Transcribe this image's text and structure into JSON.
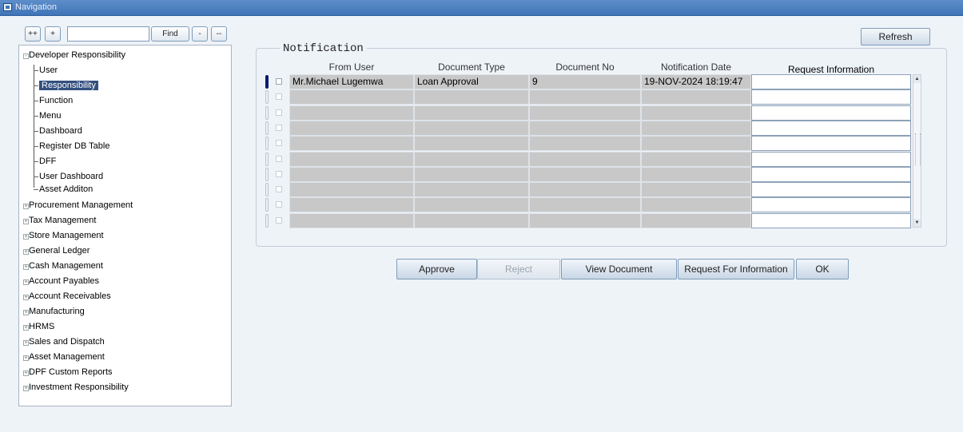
{
  "window": {
    "title": "Navigation"
  },
  "nav": {
    "expand_all_label": "++",
    "expand_label": "+",
    "search_value": "",
    "find_label": "Find",
    "collapse_label": "-",
    "collapse_all_label": "--",
    "tree": [
      {
        "label": "Developer Responsibility",
        "level": 0,
        "expanded": true
      },
      {
        "label": "User",
        "level": 1
      },
      {
        "label": "Responsibility",
        "level": 1,
        "selected": true
      },
      {
        "label": "Function",
        "level": 1
      },
      {
        "label": "Menu",
        "level": 1
      },
      {
        "label": "Dashboard",
        "level": 1
      },
      {
        "label": "Register DB Table",
        "level": 1
      },
      {
        "label": "DFF",
        "level": 1
      },
      {
        "label": "User Dashboard",
        "level": 1
      },
      {
        "label": "Asset Additon",
        "level": 1
      },
      {
        "label": "Procurement Management",
        "level": 0
      },
      {
        "label": "Tax Management",
        "level": 0
      },
      {
        "label": "Store Management",
        "level": 0
      },
      {
        "label": "General Ledger",
        "level": 0
      },
      {
        "label": "Cash Management",
        "level": 0
      },
      {
        "label": "Account Payables",
        "level": 0
      },
      {
        "label": "Account Receivables",
        "level": 0
      },
      {
        "label": "Manufacturing",
        "level": 0
      },
      {
        "label": "HRMS",
        "level": 0
      },
      {
        "label": "Sales and Dispatch",
        "level": 0
      },
      {
        "label": "Asset Management",
        "level": 0
      },
      {
        "label": "DPF Custom Reports",
        "level": 0
      },
      {
        "label": "Investment Responsibility",
        "level": 0
      }
    ]
  },
  "notification": {
    "refresh_label": "Refresh",
    "group_title": "Notification",
    "columns": {
      "from_user": "From User",
      "document_type": "Document Type",
      "document_no": "Document No",
      "notification_date": "Notification Date",
      "request_information": "Request Information"
    },
    "rows": [
      {
        "from_user": "Mr.Michael Lugemwa",
        "document_type": "Loan Approval",
        "document_no": "9",
        "notification_date": "19-NOV-2024 18:19:47",
        "request_information": ""
      },
      {
        "from_user": "",
        "document_type": "",
        "document_no": "",
        "notification_date": "",
        "request_information": ""
      },
      {
        "from_user": "",
        "document_type": "",
        "document_no": "",
        "notification_date": "",
        "request_information": ""
      },
      {
        "from_user": "",
        "document_type": "",
        "document_no": "",
        "notification_date": "",
        "request_information": ""
      },
      {
        "from_user": "",
        "document_type": "",
        "document_no": "",
        "notification_date": "",
        "request_information": ""
      },
      {
        "from_user": "",
        "document_type": "",
        "document_no": "",
        "notification_date": "",
        "request_information": ""
      },
      {
        "from_user": "",
        "document_type": "",
        "document_no": "",
        "notification_date": "",
        "request_information": ""
      },
      {
        "from_user": "",
        "document_type": "",
        "document_no": "",
        "notification_date": "",
        "request_information": ""
      },
      {
        "from_user": "",
        "document_type": "",
        "document_no": "",
        "notification_date": "",
        "request_information": ""
      },
      {
        "from_user": "",
        "document_type": "",
        "document_no": "",
        "notification_date": "",
        "request_information": ""
      }
    ],
    "actions": {
      "approve": "Approve",
      "reject": "Reject",
      "view_document": "View Document",
      "request_for_information": "Request For Information",
      "ok": "OK"
    }
  },
  "colors": {
    "title_bar": "#3f74b8",
    "selection": "#33507f",
    "current_record": "#0c1b6e"
  }
}
